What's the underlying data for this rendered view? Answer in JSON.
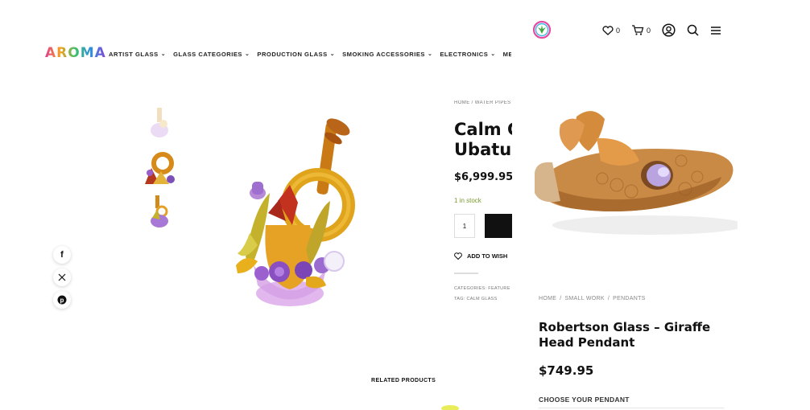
{
  "header": {
    "logo_text": "AROMA",
    "nav": [
      {
        "label": "ARTIST GLASS"
      },
      {
        "label": "GLASS CATEGORIES"
      },
      {
        "label": "PRODUCTION GLASS"
      },
      {
        "label": "SMOKING ACCESSORIES"
      },
      {
        "label": "ELECTRONICS"
      },
      {
        "label": "MERC"
      }
    ],
    "search_icon": "search-icon"
  },
  "gallery": {
    "thumbnails": [
      "thumbnail-1",
      "thumbnail-2",
      "thumbnail-3"
    ]
  },
  "social": [
    "facebook-icon",
    "x-icon",
    "pinterest-icon"
  ],
  "product": {
    "breadcrumb": "HOME  /  WATER PIPES",
    "title_line1": "Calm G",
    "title_line2": "Ubatu",
    "price": "$6,999.95",
    "stock": "1 in stock",
    "quantity": "1",
    "wishlist": "ADD TO WISH",
    "categories": "CATEGORIES: FEATURE",
    "tag": "TAG: CALM GLASS"
  },
  "related": {
    "title": "RELATED PRODUCTS"
  },
  "overlay": {
    "icons": {
      "wishlist_count": "0",
      "cart_count": "0"
    },
    "breadcrumb": [
      "HOME",
      "SMALL WORK",
      "PENDANTS"
    ],
    "breadcrumb_sep": "/",
    "title": "Robertson Glass – Giraffe Head Pendant",
    "price": "$749.95",
    "choose_label": "CHOOSE YOUR PENDANT"
  },
  "colors": {
    "stock_green": "#7a9a2f",
    "button_black": "#111111"
  }
}
